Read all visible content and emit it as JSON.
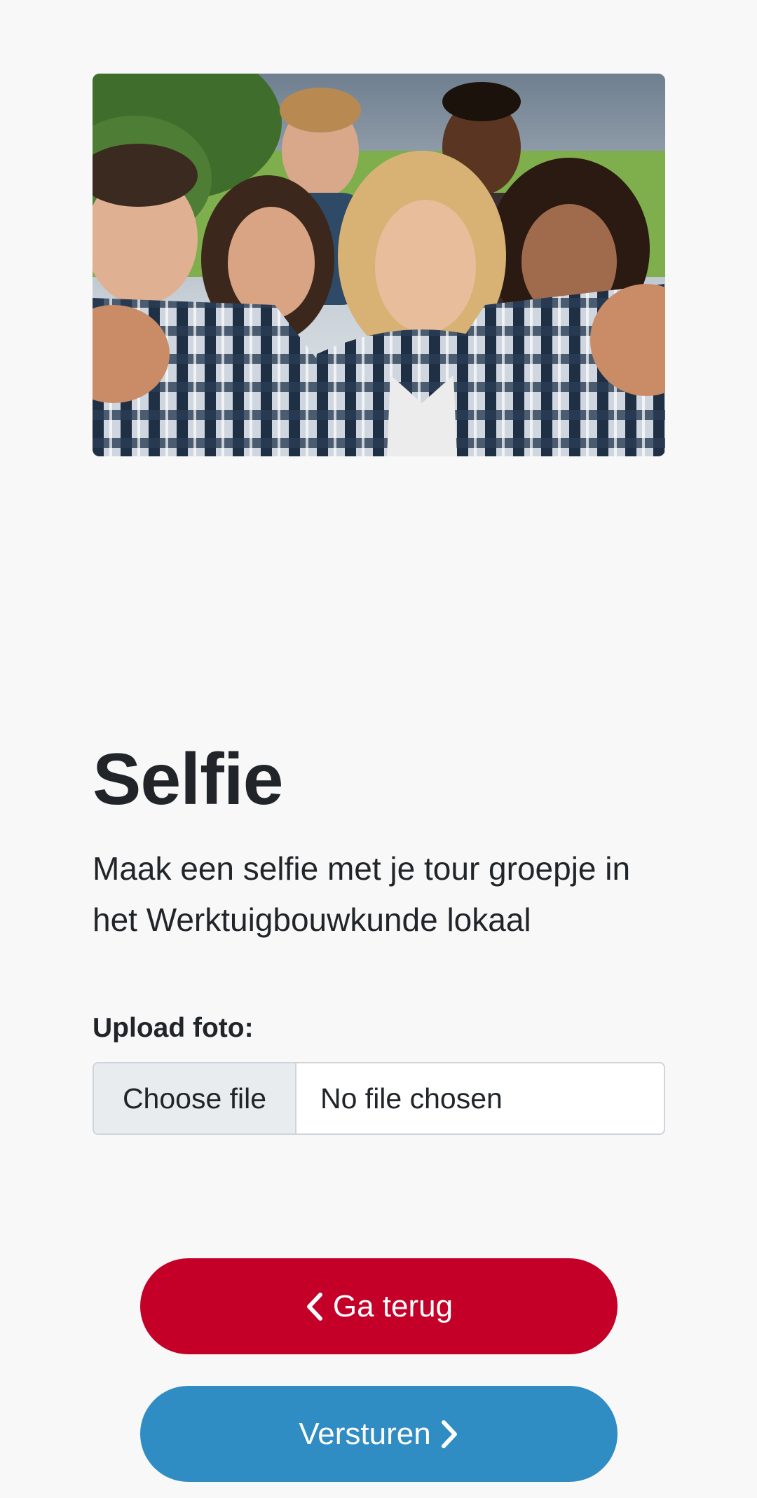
{
  "hero": {
    "alt": "Groep jongeren maakt een selfie"
  },
  "page": {
    "title": "Selfie",
    "description": "Maak een selfie met je tour groepje in het Werktuigbouwkunde lokaal"
  },
  "upload": {
    "label": "Upload foto:",
    "button_label": "Choose file",
    "status": "No file chosen"
  },
  "actions": {
    "back_label": "Ga terug",
    "send_label": "Versturen",
    "back_color": "#c40028",
    "send_color": "#2f8dc4"
  },
  "icons": {
    "back": "chevron-left-icon",
    "send": "chevron-right-icon"
  }
}
